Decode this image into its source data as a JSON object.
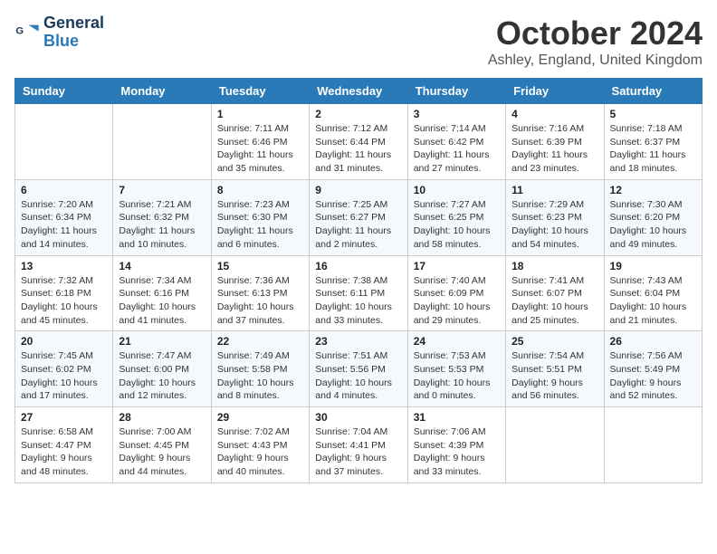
{
  "header": {
    "logo_line1": "General",
    "logo_line2": "Blue",
    "month": "October 2024",
    "location": "Ashley, England, United Kingdom"
  },
  "days_of_week": [
    "Sunday",
    "Monday",
    "Tuesday",
    "Wednesday",
    "Thursday",
    "Friday",
    "Saturday"
  ],
  "weeks": [
    [
      {
        "day": "",
        "text": ""
      },
      {
        "day": "",
        "text": ""
      },
      {
        "day": "1",
        "text": "Sunrise: 7:11 AM\nSunset: 6:46 PM\nDaylight: 11 hours and 35 minutes."
      },
      {
        "day": "2",
        "text": "Sunrise: 7:12 AM\nSunset: 6:44 PM\nDaylight: 11 hours and 31 minutes."
      },
      {
        "day": "3",
        "text": "Sunrise: 7:14 AM\nSunset: 6:42 PM\nDaylight: 11 hours and 27 minutes."
      },
      {
        "day": "4",
        "text": "Sunrise: 7:16 AM\nSunset: 6:39 PM\nDaylight: 11 hours and 23 minutes."
      },
      {
        "day": "5",
        "text": "Sunrise: 7:18 AM\nSunset: 6:37 PM\nDaylight: 11 hours and 18 minutes."
      }
    ],
    [
      {
        "day": "6",
        "text": "Sunrise: 7:20 AM\nSunset: 6:34 PM\nDaylight: 11 hours and 14 minutes."
      },
      {
        "day": "7",
        "text": "Sunrise: 7:21 AM\nSunset: 6:32 PM\nDaylight: 11 hours and 10 minutes."
      },
      {
        "day": "8",
        "text": "Sunrise: 7:23 AM\nSunset: 6:30 PM\nDaylight: 11 hours and 6 minutes."
      },
      {
        "day": "9",
        "text": "Sunrise: 7:25 AM\nSunset: 6:27 PM\nDaylight: 11 hours and 2 minutes."
      },
      {
        "day": "10",
        "text": "Sunrise: 7:27 AM\nSunset: 6:25 PM\nDaylight: 10 hours and 58 minutes."
      },
      {
        "day": "11",
        "text": "Sunrise: 7:29 AM\nSunset: 6:23 PM\nDaylight: 10 hours and 54 minutes."
      },
      {
        "day": "12",
        "text": "Sunrise: 7:30 AM\nSunset: 6:20 PM\nDaylight: 10 hours and 49 minutes."
      }
    ],
    [
      {
        "day": "13",
        "text": "Sunrise: 7:32 AM\nSunset: 6:18 PM\nDaylight: 10 hours and 45 minutes."
      },
      {
        "day": "14",
        "text": "Sunrise: 7:34 AM\nSunset: 6:16 PM\nDaylight: 10 hours and 41 minutes."
      },
      {
        "day": "15",
        "text": "Sunrise: 7:36 AM\nSunset: 6:13 PM\nDaylight: 10 hours and 37 minutes."
      },
      {
        "day": "16",
        "text": "Sunrise: 7:38 AM\nSunset: 6:11 PM\nDaylight: 10 hours and 33 minutes."
      },
      {
        "day": "17",
        "text": "Sunrise: 7:40 AM\nSunset: 6:09 PM\nDaylight: 10 hours and 29 minutes."
      },
      {
        "day": "18",
        "text": "Sunrise: 7:41 AM\nSunset: 6:07 PM\nDaylight: 10 hours and 25 minutes."
      },
      {
        "day": "19",
        "text": "Sunrise: 7:43 AM\nSunset: 6:04 PM\nDaylight: 10 hours and 21 minutes."
      }
    ],
    [
      {
        "day": "20",
        "text": "Sunrise: 7:45 AM\nSunset: 6:02 PM\nDaylight: 10 hours and 17 minutes."
      },
      {
        "day": "21",
        "text": "Sunrise: 7:47 AM\nSunset: 6:00 PM\nDaylight: 10 hours and 12 minutes."
      },
      {
        "day": "22",
        "text": "Sunrise: 7:49 AM\nSunset: 5:58 PM\nDaylight: 10 hours and 8 minutes."
      },
      {
        "day": "23",
        "text": "Sunrise: 7:51 AM\nSunset: 5:56 PM\nDaylight: 10 hours and 4 minutes."
      },
      {
        "day": "24",
        "text": "Sunrise: 7:53 AM\nSunset: 5:53 PM\nDaylight: 10 hours and 0 minutes."
      },
      {
        "day": "25",
        "text": "Sunrise: 7:54 AM\nSunset: 5:51 PM\nDaylight: 9 hours and 56 minutes."
      },
      {
        "day": "26",
        "text": "Sunrise: 7:56 AM\nSunset: 5:49 PM\nDaylight: 9 hours and 52 minutes."
      }
    ],
    [
      {
        "day": "27",
        "text": "Sunrise: 6:58 AM\nSunset: 4:47 PM\nDaylight: 9 hours and 48 minutes."
      },
      {
        "day": "28",
        "text": "Sunrise: 7:00 AM\nSunset: 4:45 PM\nDaylight: 9 hours and 44 minutes."
      },
      {
        "day": "29",
        "text": "Sunrise: 7:02 AM\nSunset: 4:43 PM\nDaylight: 9 hours and 40 minutes."
      },
      {
        "day": "30",
        "text": "Sunrise: 7:04 AM\nSunset: 4:41 PM\nDaylight: 9 hours and 37 minutes."
      },
      {
        "day": "31",
        "text": "Sunrise: 7:06 AM\nSunset: 4:39 PM\nDaylight: 9 hours and 33 minutes."
      },
      {
        "day": "",
        "text": ""
      },
      {
        "day": "",
        "text": ""
      }
    ]
  ]
}
